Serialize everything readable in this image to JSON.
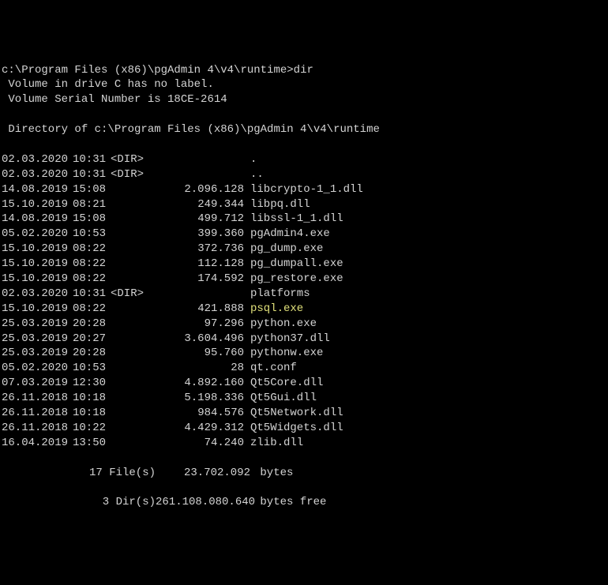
{
  "prompt": {
    "path": "c:\\Program Files (x86)\\pgAdmin 4\\v4\\runtime>",
    "command": "dir"
  },
  "volume": {
    "line1": " Volume in drive C has no label.",
    "line2": " Volume Serial Number is 18CE-2614"
  },
  "directory_header": " Directory of c:\\Program Files (x86)\\pgAdmin 4\\v4\\runtime",
  "entries": [
    {
      "date": "02.03.2020",
      "time": "10:31",
      "dir": "<DIR>",
      "size": "",
      "name": "."
    },
    {
      "date": "02.03.2020",
      "time": "10:31",
      "dir": "<DIR>",
      "size": "",
      "name": ".."
    },
    {
      "date": "14.08.2019",
      "time": "15:08",
      "dir": "",
      "size": "2.096.128",
      "name": "libcrypto-1_1.dll"
    },
    {
      "date": "15.10.2019",
      "time": "08:21",
      "dir": "",
      "size": "249.344",
      "name": "libpq.dll"
    },
    {
      "date": "14.08.2019",
      "time": "15:08",
      "dir": "",
      "size": "499.712",
      "name": "libssl-1_1.dll"
    },
    {
      "date": "05.02.2020",
      "time": "10:53",
      "dir": "",
      "size": "399.360",
      "name": "pgAdmin4.exe"
    },
    {
      "date": "15.10.2019",
      "time": "08:22",
      "dir": "",
      "size": "372.736",
      "name": "pg_dump.exe"
    },
    {
      "date": "15.10.2019",
      "time": "08:22",
      "dir": "",
      "size": "112.128",
      "name": "pg_dumpall.exe"
    },
    {
      "date": "15.10.2019",
      "time": "08:22",
      "dir": "",
      "size": "174.592",
      "name": "pg_restore.exe"
    },
    {
      "date": "02.03.2020",
      "time": "10:31",
      "dir": "<DIR>",
      "size": "",
      "name": "platforms"
    },
    {
      "date": "15.10.2019",
      "time": "08:22",
      "dir": "",
      "size": "421.888",
      "name": "psql.exe",
      "highlight": true
    },
    {
      "date": "25.03.2019",
      "time": "20:28",
      "dir": "",
      "size": "97.296",
      "name": "python.exe"
    },
    {
      "date": "25.03.2019",
      "time": "20:27",
      "dir": "",
      "size": "3.604.496",
      "name": "python37.dll"
    },
    {
      "date": "25.03.2019",
      "time": "20:28",
      "dir": "",
      "size": "95.760",
      "name": "pythonw.exe"
    },
    {
      "date": "05.02.2020",
      "time": "10:53",
      "dir": "",
      "size": "28",
      "name": "qt.conf"
    },
    {
      "date": "07.03.2019",
      "time": "12:30",
      "dir": "",
      "size": "4.892.160",
      "name": "Qt5Core.dll"
    },
    {
      "date": "26.11.2018",
      "time": "10:18",
      "dir": "",
      "size": "5.198.336",
      "name": "Qt5Gui.dll"
    },
    {
      "date": "26.11.2018",
      "time": "10:18",
      "dir": "",
      "size": "984.576",
      "name": "Qt5Network.dll"
    },
    {
      "date": "26.11.2018",
      "time": "10:22",
      "dir": "",
      "size": "4.429.312",
      "name": "Qt5Widgets.dll"
    },
    {
      "date": "16.04.2019",
      "time": "13:50",
      "dir": "",
      "size": "74.240",
      "name": "zlib.dll"
    }
  ],
  "summary": {
    "files_label": "17 File(s)",
    "files_bytes": "23.702.092",
    "files_unit": "bytes",
    "dirs_label": "3 Dir(s)",
    "dirs_bytes": "261.108.080.640",
    "dirs_unit": "bytes free"
  }
}
